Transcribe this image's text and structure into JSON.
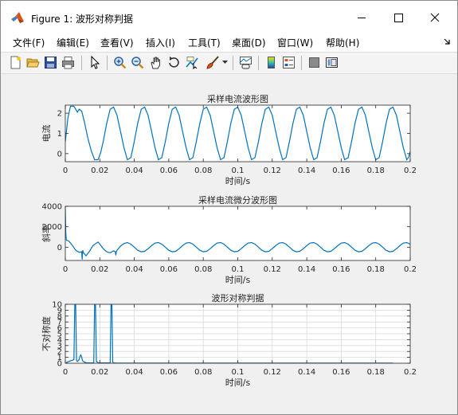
{
  "window": {
    "title": "Figure 1: 波形对称判据"
  },
  "menu": [
    "文件(F)",
    "编辑(E)",
    "查看(V)",
    "插入(I)",
    "工具(T)",
    "桌面(D)",
    "窗口(W)",
    "帮助(H)"
  ],
  "toolbar_icons": [
    "new-figure-icon",
    "open-file-icon",
    "save-icon",
    "print-icon",
    "pointer-icon",
    "zoom-in-icon",
    "zoom-out-icon",
    "pan-hand-icon",
    "rotate-3d-icon",
    "data-cursor-icon",
    "brush-icon",
    "brush-dropdown-icon",
    "link-plot-icon",
    "colorbar-icon",
    "legend-icon",
    "hide-plot-tools-icon",
    "show-plot-tools-icon"
  ],
  "colors": {
    "line": "#0072BD",
    "axes_bg": "#ffffff",
    "figure_bg": "#f0f0f0",
    "grid": "#d9d9d9"
  },
  "chart_data": [
    {
      "type": "line",
      "title": "采样电流波形图",
      "xlabel": "时间/s",
      "ylabel": "电流",
      "xlim": [
        0,
        0.2
      ],
      "ylim": [
        -0.4,
        2.4
      ],
      "xticks": [
        0,
        0.02,
        0.04,
        0.06,
        0.08,
        0.1,
        0.12,
        0.14,
        0.16,
        0.18,
        0.2
      ],
      "xtick_labels": [
        "0",
        "0.02",
        "0.04",
        "0.06",
        "0.08",
        "0.1",
        "0.12",
        "0.14",
        "0.16",
        "0.18",
        "0.2"
      ],
      "yticks": [
        0,
        1,
        2
      ],
      "ytick_labels": [
        "0",
        "1",
        "2"
      ],
      "grid": false,
      "series": [
        {
          "x": [
            0,
            0.0015,
            0.003,
            0.005,
            0.007,
            0.008,
            0.0095,
            0.011,
            0.013,
            0.015,
            0.017,
            0.019,
            0.0205,
            0.022,
            0.024,
            0.026,
            0.028,
            0.03,
            0.032,
            0.034,
            0.036,
            0.038,
            0.04,
            0.042,
            0.044,
            0.046,
            0.048,
            0.05,
            0.052,
            0.054,
            0.056,
            0.058,
            0.06,
            0.062,
            0.064,
            0.066,
            0.068,
            0.07,
            0.072,
            0.074,
            0.076,
            0.078,
            0.08,
            0.082,
            0.084,
            0.086,
            0.088,
            0.09,
            0.092,
            0.094,
            0.096,
            0.098,
            0.1,
            0.102,
            0.104,
            0.106,
            0.108,
            0.11,
            0.112,
            0.114,
            0.116,
            0.118,
            0.12,
            0.122,
            0.124,
            0.126,
            0.128,
            0.13,
            0.132,
            0.134,
            0.136,
            0.138,
            0.14,
            0.142,
            0.144,
            0.146,
            0.148,
            0.15,
            0.152,
            0.154,
            0.156,
            0.158,
            0.16,
            0.162,
            0.164,
            0.166,
            0.168,
            0.17,
            0.172,
            0.174,
            0.176,
            0.178,
            0.18,
            0.182,
            0.184,
            0.186,
            0.188,
            0.19,
            0.192,
            0.194,
            0.196,
            0.198,
            0.199,
            0.2
          ],
          "values": [
            0.6,
            1.75,
            2.35,
            2.35,
            2.05,
            2.2,
            2.1,
            1.6,
            0.8,
            0.15,
            -0.3,
            -0.3,
            0.05,
            0.6,
            1.5,
            2.2,
            2.3,
            1.9,
            1.1,
            0.3,
            -0.3,
            -0.2,
            0.6,
            1.5,
            2.2,
            2.3,
            1.9,
            1.1,
            0.3,
            -0.3,
            -0.2,
            0.6,
            1.5,
            2.2,
            2.3,
            1.9,
            1.1,
            0.3,
            -0.3,
            -0.2,
            0.6,
            1.5,
            2.2,
            2.3,
            1.9,
            1.1,
            0.3,
            -0.3,
            -0.2,
            0.6,
            1.5,
            2.2,
            2.3,
            1.9,
            1.1,
            0.3,
            -0.3,
            -0.2,
            0.6,
            1.5,
            2.2,
            2.3,
            1.9,
            1.1,
            0.3,
            -0.3,
            -0.2,
            0.6,
            1.5,
            2.2,
            2.3,
            1.9,
            1.1,
            0.3,
            -0.3,
            -0.2,
            0.6,
            1.5,
            2.2,
            2.3,
            1.9,
            1.1,
            0.3,
            -0.3,
            -0.2,
            0.6,
            1.5,
            2.2,
            2.3,
            1.9,
            1.1,
            0.3,
            -0.3,
            -0.2,
            0.6,
            1.5,
            2.2,
            2.3,
            1.9,
            1.1,
            0.3,
            -0.3,
            -0.2,
            0.1
          ]
        }
      ]
    },
    {
      "type": "line",
      "title": "采样电流微分波形图",
      "xlabel": "时间/s",
      "ylabel": "斜率",
      "xlim": [
        0,
        0.2
      ],
      "ylim": [
        -1300,
        4000
      ],
      "xticks": [
        0,
        0.02,
        0.04,
        0.06,
        0.08,
        0.1,
        0.12,
        0.14,
        0.16,
        0.18,
        0.2
      ],
      "xtick_labels": [
        "0",
        "0.02",
        "0.04",
        "0.06",
        "0.08",
        "0.1",
        "0.12",
        "0.14",
        "0.16",
        "0.18",
        "0.2"
      ],
      "yticks": [
        0,
        2000,
        4000
      ],
      "ytick_labels": [
        "0",
        "2000",
        "4000"
      ],
      "grid": false,
      "series": [
        {
          "x": [
            0,
            0.0003,
            0.0006,
            0.002,
            0.004,
            0.006,
            0.008,
            0.0095,
            0.0098,
            0.0101,
            0.0104,
            0.012,
            0.014,
            0.016,
            0.018,
            0.019,
            0.02,
            0.022,
            0.024,
            0.026,
            0.028,
            0.029,
            0.0293,
            0.0296,
            0.03,
            0.032,
            0.034,
            0.036,
            0.038,
            0.04,
            0.042,
            0.044,
            0.046,
            0.048,
            0.05,
            0.052,
            0.054,
            0.056,
            0.058,
            0.06,
            0.062,
            0.064,
            0.066,
            0.068,
            0.07,
            0.072,
            0.074,
            0.076,
            0.078,
            0.08,
            0.082,
            0.084,
            0.086,
            0.088,
            0.09,
            0.092,
            0.094,
            0.096,
            0.098,
            0.1,
            0.102,
            0.104,
            0.106,
            0.108,
            0.11,
            0.112,
            0.114,
            0.116,
            0.118,
            0.12,
            0.122,
            0.124,
            0.126,
            0.128,
            0.13,
            0.132,
            0.134,
            0.136,
            0.138,
            0.14,
            0.142,
            0.144,
            0.146,
            0.148,
            0.15,
            0.152,
            0.154,
            0.156,
            0.158,
            0.16,
            0.162,
            0.164,
            0.166,
            0.168,
            0.17,
            0.172,
            0.174,
            0.176,
            0.178,
            0.18,
            0.182,
            0.184,
            0.186,
            0.188,
            0.19,
            0.192,
            0.194,
            0.196,
            0.198,
            0.2
          ],
          "values": [
            3700,
            1400,
            700,
            600,
            200,
            -300,
            -500,
            -450,
            -1200,
            -300,
            -500,
            -850,
            -400,
            150,
            400,
            500,
            300,
            -150,
            -450,
            -550,
            -350,
            -450,
            -800,
            -400,
            -300,
            100,
            350,
            450,
            300,
            0,
            -300,
            -450,
            -400,
            -150,
            150,
            400,
            450,
            300,
            0,
            -300,
            -450,
            -400,
            -150,
            150,
            400,
            450,
            300,
            0,
            -300,
            -450,
            -400,
            -150,
            150,
            400,
            450,
            300,
            0,
            -300,
            -450,
            -400,
            -150,
            150,
            400,
            450,
            300,
            0,
            -300,
            -450,
            -400,
            -150,
            150,
            400,
            450,
            300,
            0,
            -300,
            -450,
            -400,
            -150,
            150,
            400,
            450,
            300,
            0,
            -300,
            -450,
            -400,
            -150,
            150,
            400,
            450,
            300,
            0,
            -300,
            -450,
            -400,
            -150,
            150,
            400,
            450,
            300,
            0,
            -300,
            -450,
            -400,
            -150,
            150,
            400,
            450,
            300
          ]
        }
      ]
    },
    {
      "type": "line",
      "title": "波形对称判据",
      "xlabel": "时间/s",
      "ylabel": "不对称度",
      "xlim": [
        0,
        0.2
      ],
      "ylim": [
        0,
        10
      ],
      "xticks": [
        0,
        0.02,
        0.04,
        0.06,
        0.08,
        0.1,
        0.12,
        0.14,
        0.16,
        0.18,
        0.2
      ],
      "xtick_labels": [
        "0",
        "0.02",
        "0.04",
        "0.06",
        "0.08",
        "0.1",
        "0.12",
        "0.14",
        "0.16",
        "0.18",
        "0.2"
      ],
      "yticks": [
        0,
        1,
        2,
        3,
        4,
        5,
        6,
        7,
        8,
        9,
        10
      ],
      "ytick_labels": [
        "0",
        "1",
        "2",
        "3",
        "4",
        "5",
        "6",
        "7",
        "8",
        "9",
        "10"
      ],
      "grid": true,
      "series": [
        {
          "x": [
            0.0005,
            0.001,
            0.002,
            0.003,
            0.004,
            0.005,
            0.0055,
            0.006,
            0.0065,
            0.007,
            0.008,
            0.0085,
            0.009,
            0.0095,
            0.01,
            0.011,
            0.012,
            0.014,
            0.0165,
            0.017,
            0.0175,
            0.018,
            0.019,
            0.02,
            0.024,
            0.026,
            0.0265,
            0.027,
            0.0275,
            0.028,
            0.03,
            0.05,
            0.1,
            0.15,
            0.19
          ],
          "values": [
            0,
            0.2,
            0.3,
            0.4,
            0.5,
            0.6,
            10,
            10,
            0.4,
            0.3,
            0.6,
            1.2,
            1.4,
            1.0,
            0.4,
            0.2,
            0.1,
            0.05,
            0.05,
            10,
            10,
            0.3,
            0.1,
            0.05,
            0.05,
            0.05,
            10,
            10,
            0.2,
            0.05,
            0.03,
            0.02,
            0.02,
            0.02,
            0.02
          ]
        }
      ]
    }
  ]
}
